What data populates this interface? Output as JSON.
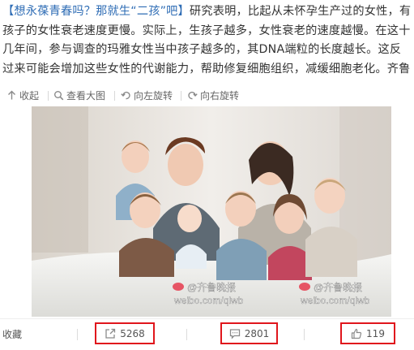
{
  "post": {
    "topic": "【想永葆青春吗？那就生“二孩”吧】",
    "body": "研究表明，比起从未怀孕生产过的女性，有孩子的女性衰老速度更慢。实际上，生孩子越多，女性衰老的速度越慢。在这十几年间，参与调查的玛雅女性当中孩子越多的，其DNA端粒的长度越长。这反过来可能会增加这些女性的代谢能力，帮助修复细胞组织，减缓细胞老化。",
    "source_tail": "齐鲁"
  },
  "toolbar": {
    "collapse_label": "收起",
    "view_large_label": "查看大图",
    "rotate_left_label": "向左旋转",
    "rotate_right_label": "向右旋转"
  },
  "image": {
    "watermark_left_name": "@齐鲁晚报",
    "watermark_left_url": "weibo.com/qlwb",
    "watermark_right_name": "@齐鲁晚报",
    "watermark_right_url": "weibo.com/qlwb"
  },
  "actions": {
    "favorite_label": "收藏",
    "repost_count": "5268",
    "comment_count": "2801",
    "like_count": "119"
  },
  "colors": {
    "highlight_border": "#e0161c",
    "link": "#2f6db5",
    "icon_gray": "#8a8a8a"
  },
  "icons": {
    "collapse": "arrow-up-icon",
    "view_large": "magnifier-icon",
    "rotate_left": "rotate-left-icon",
    "rotate_right": "rotate-right-icon",
    "repost": "share-arrow-icon",
    "comment": "comment-bubble-icon",
    "like": "thumbs-up-icon"
  }
}
